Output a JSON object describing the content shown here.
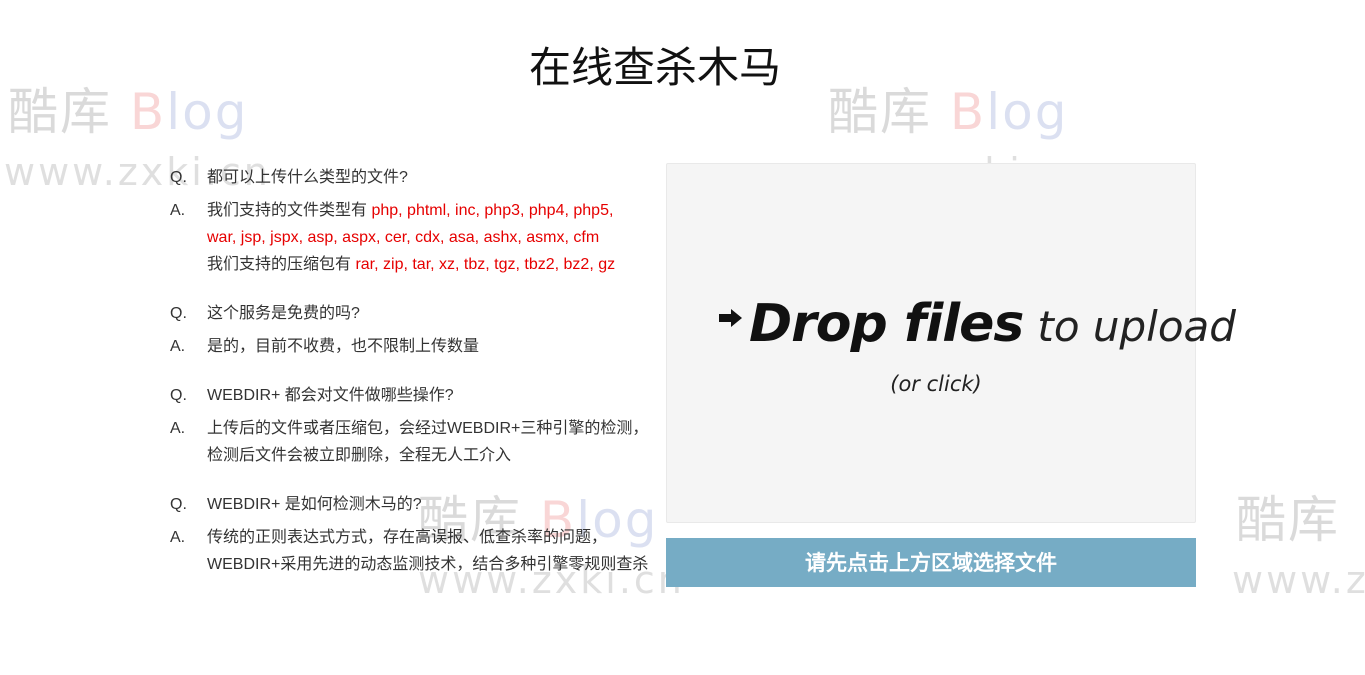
{
  "page": {
    "title": "在线查杀木马"
  },
  "watermark": {
    "brand_cn": "酷库",
    "brand_b": "B",
    "brand_log": "log",
    "url": "www.zxki.cn"
  },
  "faq": [
    {
      "q_tag": "Q.",
      "question": "都可以上传什么类型的文件?",
      "a_tag": "A.",
      "answer_lines": [
        {
          "prefix": "我们支持的文件类型有 ",
          "highlight": "php, phtml, inc, php3, php4, php5,"
        },
        {
          "prefix": "",
          "highlight": "war, jsp, jspx, asp, aspx, cer, cdx, asa, ashx, asmx, cfm"
        },
        {
          "prefix": "我们支持的压缩包有 ",
          "highlight": "rar, zip, tar, xz, tbz, tgz, tbz2, bz2, gz"
        }
      ]
    },
    {
      "q_tag": "Q.",
      "question": "这个服务是免费的吗?",
      "a_tag": "A.",
      "answer": "是的，目前不收费，也不限制上传数量"
    },
    {
      "q_tag": "Q.",
      "question": "WEBDIR+ 都会对文件做哪些操作?",
      "a_tag": "A.",
      "answer": "上传后的文件或者压缩包，会经过WEBDIR+三种引擎的检测，检测后文件会被立即删除，全程无人工介入"
    },
    {
      "q_tag": "Q.",
      "question": "WEBDIR+ 是如何检测木马的?",
      "a_tag": "A.",
      "answer": "传统的正则表达式方式，存在高误报、低查杀率的问题，WEBDIR+采用先进的动态监测技术，结合多种引擎零规则查杀"
    }
  ],
  "dropzone": {
    "icon": "arrow-right-icon",
    "strong": "Drop files",
    "light": "to upload",
    "hint": "(or click)"
  },
  "upload_button": {
    "label": "请先点击上方区域选择文件",
    "color": "#76acc5"
  }
}
